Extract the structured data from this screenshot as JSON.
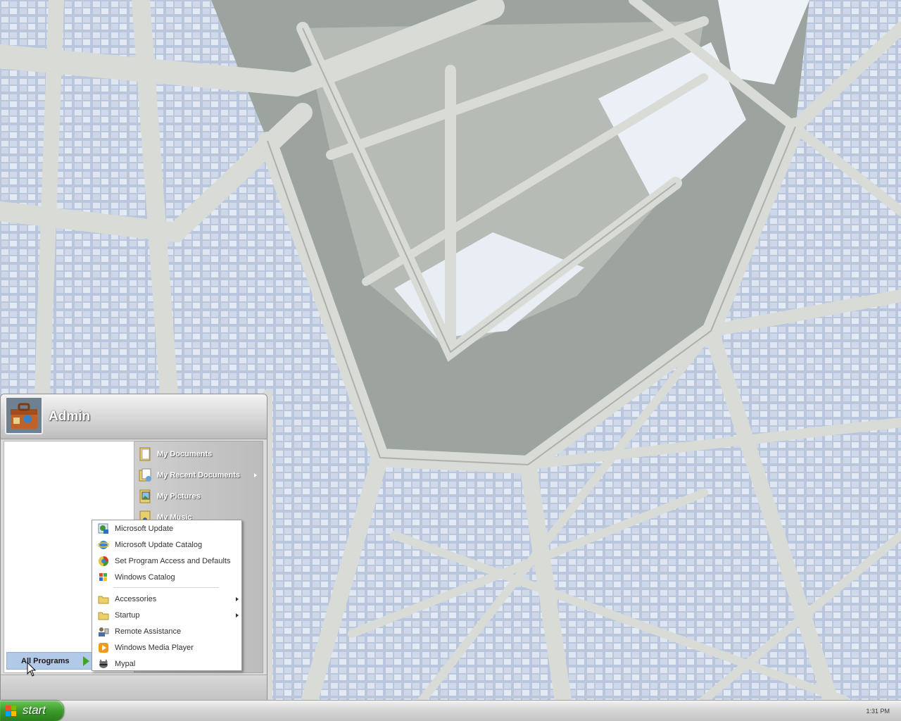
{
  "user": {
    "name": "Admin"
  },
  "places": [
    {
      "label": "My Documents",
      "icon": "documents-folder-icon",
      "has_submenu": false
    },
    {
      "label": "My Recent Documents",
      "icon": "recent-documents-icon",
      "has_submenu": true
    },
    {
      "label": "My Pictures",
      "icon": "pictures-folder-icon",
      "has_submenu": false
    },
    {
      "label": "My Music",
      "icon": "music-folder-icon",
      "has_submenu": false
    }
  ],
  "all_programs": {
    "label": "All Programs"
  },
  "programs": [
    {
      "label": "Microsoft Update",
      "icon": "microsoft-update-icon",
      "has_submenu": false
    },
    {
      "label": "Microsoft Update Catalog",
      "icon": "ie-globe-icon",
      "has_submenu": false
    },
    {
      "label": "Set Program Access and Defaults",
      "icon": "program-access-icon",
      "has_submenu": false
    },
    {
      "label": "Windows Catalog",
      "icon": "windows-catalog-icon",
      "has_submenu": false
    },
    {
      "label": "Accessories",
      "icon": "folder-icon",
      "has_submenu": true
    },
    {
      "label": "Startup",
      "icon": "folder-icon",
      "has_submenu": true
    },
    {
      "label": "Remote Assistance",
      "icon": "remote-assistance-icon",
      "has_submenu": false
    },
    {
      "label": "Windows Media Player",
      "icon": "media-player-icon",
      "has_submenu": false
    },
    {
      "label": "Mypal",
      "icon": "mypal-icon",
      "has_submenu": false
    }
  ],
  "taskbar": {
    "start_label": "start",
    "clock": "1:31 PM"
  },
  "colors": {
    "start_green": "#3d9b2c",
    "taskbar_silver": "#d9d9d9",
    "all_programs_highlight": "#b3c9e8"
  }
}
